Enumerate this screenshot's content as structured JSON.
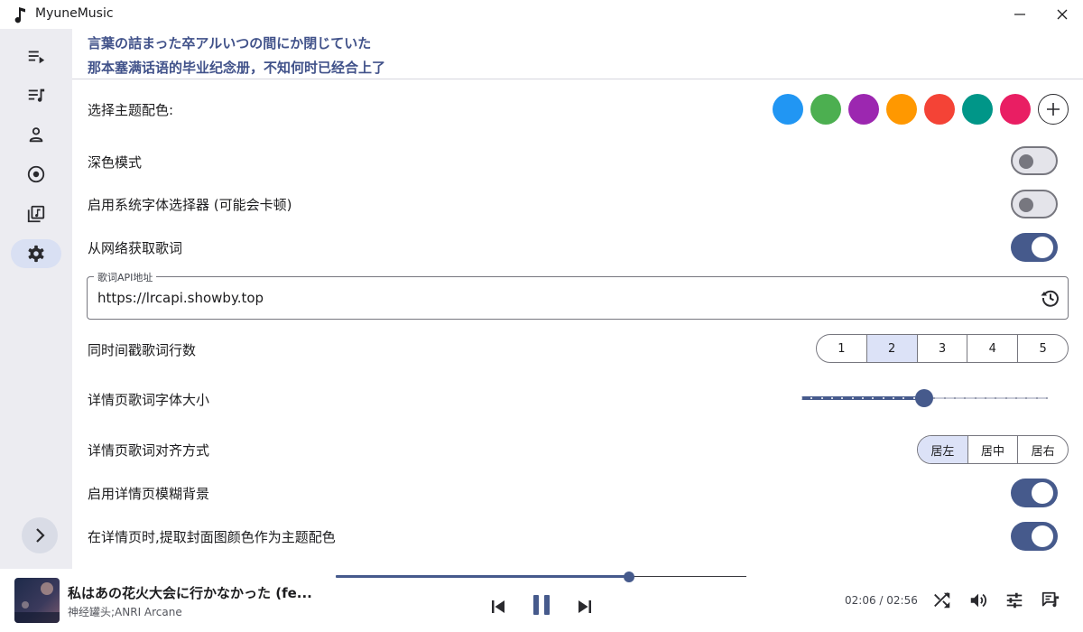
{
  "window": {
    "title": "MyuneMusic"
  },
  "lyrics": {
    "line1": "言葉の詰まった卒アルいつの間にか閉じていた",
    "line2": "那本塞满话语的毕业纪念册，不知何时已经合上了"
  },
  "sidebar": {
    "items": [
      {
        "icon": "queue-icon",
        "active": false
      },
      {
        "icon": "playlist-icon",
        "active": false
      },
      {
        "icon": "artist-icon",
        "active": false
      },
      {
        "icon": "album-icon",
        "active": false
      },
      {
        "icon": "library-icon",
        "active": false
      },
      {
        "icon": "gear-icon",
        "active": true
      }
    ]
  },
  "settings": {
    "theme_color": {
      "label": "选择主题配色:",
      "swatches": [
        "#2196f3",
        "#4caf50",
        "#9c27b0",
        "#ff9800",
        "#f44336",
        "#009688",
        "#e91e63"
      ]
    },
    "dark_mode": {
      "label": "深色模式",
      "on": false
    },
    "system_font_picker": {
      "label": "启用系统字体选择器 (可能会卡顿)",
      "on": false
    },
    "online_lyrics": {
      "label": "从网络获取歌词",
      "on": true
    },
    "lyrics_api": {
      "legend": "歌词API地址",
      "value": "https://lrcapi.showby.top"
    },
    "lyric_lines": {
      "label": "同时间戳歌词行数",
      "options": [
        "1",
        "2",
        "3",
        "4",
        "5"
      ],
      "selected": 1
    },
    "lyric_font_size": {
      "label": "详情页歌词字体大小",
      "value_fraction": 0.5
    },
    "lyric_align": {
      "label": "详情页歌词对齐方式",
      "options": [
        "居左",
        "居中",
        "居右"
      ],
      "selected": 0
    },
    "blur_background": {
      "label": "启用详情页模糊背景",
      "on": true
    },
    "cover_theme_color": {
      "label": "在详情页时,提取封面图颜色作为主题配色",
      "on": true
    }
  },
  "player": {
    "title": "私はあの花火大会に行かなかった (fe...",
    "artist": "神经罐头;ANRI Arcane",
    "time": "02:06 / 02:56",
    "progress_fraction": 0.716,
    "accent": "#465a8c"
  }
}
